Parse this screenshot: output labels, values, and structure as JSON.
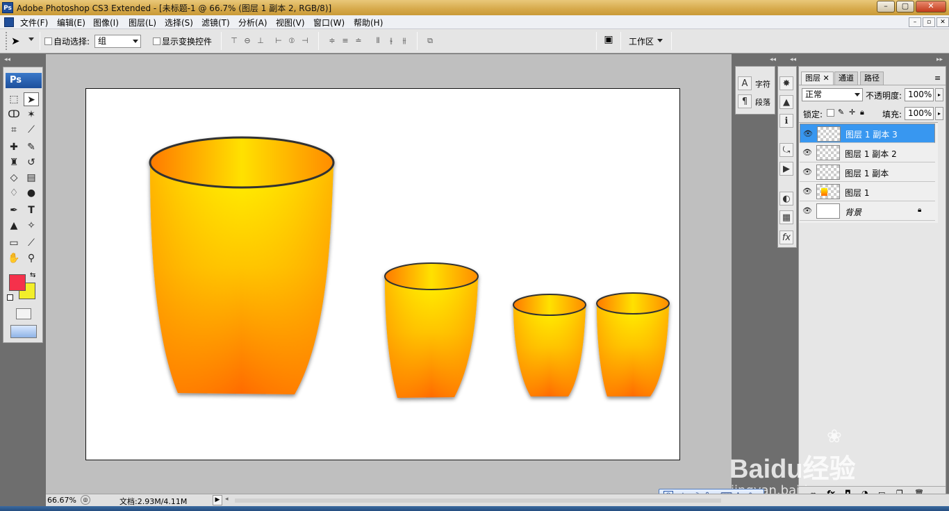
{
  "window": {
    "title": "Adobe Photoshop CS3 Extended - [未标题-1 @ 66.7% (图层 1 副本 2, RGB/8)]",
    "app_icon": "Ps"
  },
  "menu": {
    "items": [
      "文件(F)",
      "编辑(E)",
      "图像(I)",
      "图层(L)",
      "选择(S)",
      "滤镜(T)",
      "分析(A)",
      "视图(V)",
      "窗口(W)",
      "帮助(H)"
    ]
  },
  "options": {
    "auto_select_label": "自动选择:",
    "auto_select_value": "组",
    "show_transform_label": "显示变换控件",
    "workspace_label": "工作区"
  },
  "toolbox": {
    "logo": "Ps",
    "foreground_color": "#f5314b",
    "background_color": "#f2ee2a"
  },
  "panels": {
    "char_label": "字符",
    "para_label": "段落"
  },
  "layers_panel": {
    "tabs": [
      "图层",
      "通道",
      "路径"
    ],
    "blend_mode": "正常",
    "opacity_label": "不透明度:",
    "opacity_value": "100%",
    "lock_label": "锁定:",
    "fill_label": "填充:",
    "fill_value": "100%",
    "layers": [
      {
        "name": "图层 1 副本 3",
        "selected": true
      },
      {
        "name": "图层 1 副本 2",
        "selected": false
      },
      {
        "name": "图层 1 副本",
        "selected": false
      },
      {
        "name": "图层 1",
        "selected": false
      },
      {
        "name": "背景",
        "selected": false
      }
    ]
  },
  "status": {
    "zoom": "66.67%",
    "doc_info": "文档:2.93M/4.11M"
  },
  "ime": {
    "lang": "中"
  },
  "watermark": {
    "brand": "Baidu经验",
    "url": "jingyan.baidu.com"
  }
}
